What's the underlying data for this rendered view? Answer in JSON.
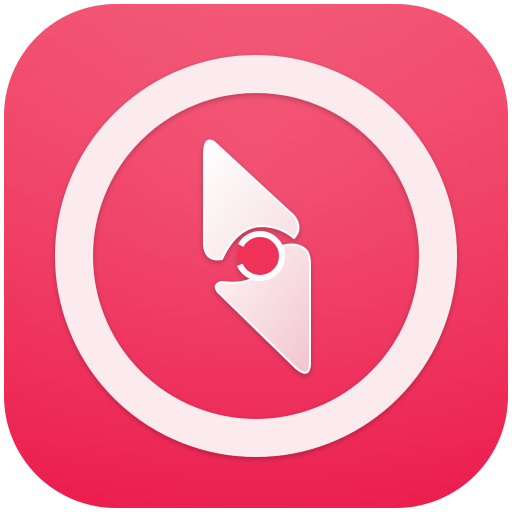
{
  "app_icon": {
    "icon_name": "compass-icon",
    "colors": {
      "background_top": "#F24E6E",
      "background_bottom": "#EC1D4E",
      "ring": "#FCEBEE",
      "needle_light": "#FFF6F7",
      "needle_shade": "#F3C9D1"
    }
  }
}
